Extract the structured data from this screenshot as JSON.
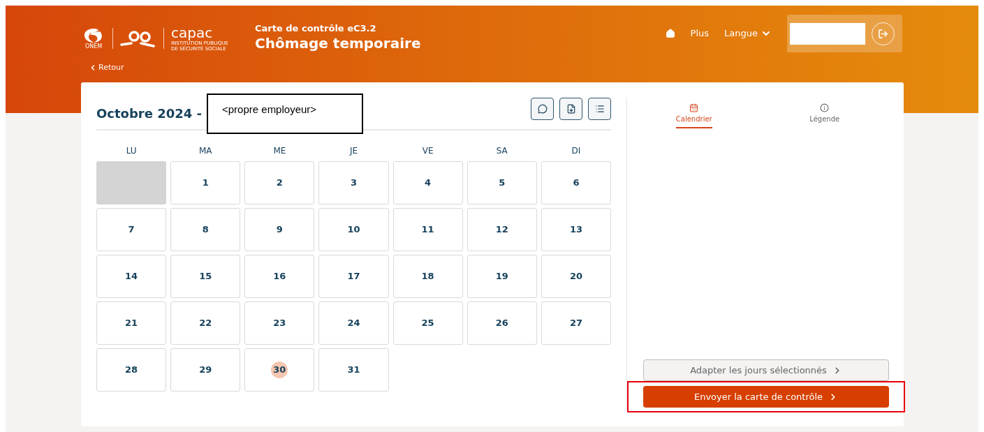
{
  "header": {
    "logo": {
      "onem": "ONEM",
      "capac": "capac",
      "capac_subtitle": "INSTITUTION PUBLIQUE DE SÉCURITÉ SOCIALE"
    },
    "subtitle": "Carte de contrôle eC3.2",
    "title": "Chômage temporaire",
    "nav": [
      {
        "kind": "home"
      },
      {
        "kind": "link",
        "label": "Plus"
      },
      {
        "kind": "dropdown",
        "label": "Langue"
      }
    ],
    "back": "Retour"
  },
  "calendar": {
    "title": "Octobre 2024 -",
    "employer_label": "<propre employeur>",
    "weekdays": [
      "LU",
      "MA",
      "ME",
      "JE",
      "VE",
      "SA",
      "DI"
    ],
    "days": [
      {
        "kind": "outside"
      },
      {
        "kind": "day",
        "label": "1",
        "today": false
      },
      {
        "kind": "day",
        "label": "2",
        "today": false
      },
      {
        "kind": "day",
        "label": "3",
        "today": false
      },
      {
        "kind": "day",
        "label": "4",
        "today": false
      },
      {
        "kind": "day",
        "label": "5",
        "today": false
      },
      {
        "kind": "day",
        "label": "6",
        "today": false
      },
      {
        "kind": "day",
        "label": "7",
        "today": false
      },
      {
        "kind": "day",
        "label": "8",
        "today": false
      },
      {
        "kind": "day",
        "label": "9",
        "today": false
      },
      {
        "kind": "day",
        "label": "10",
        "today": false
      },
      {
        "kind": "day",
        "label": "11",
        "today": false
      },
      {
        "kind": "day",
        "label": "12",
        "today": false
      },
      {
        "kind": "day",
        "label": "13",
        "today": false
      },
      {
        "kind": "day",
        "label": "14",
        "today": false
      },
      {
        "kind": "day",
        "label": "15",
        "today": false
      },
      {
        "kind": "day",
        "label": "16",
        "today": false
      },
      {
        "kind": "day",
        "label": "17",
        "today": false
      },
      {
        "kind": "day",
        "label": "18",
        "today": false
      },
      {
        "kind": "day",
        "label": "19",
        "today": false
      },
      {
        "kind": "day",
        "label": "20",
        "today": false
      },
      {
        "kind": "day",
        "label": "21",
        "today": false
      },
      {
        "kind": "day",
        "label": "22",
        "today": false
      },
      {
        "kind": "day",
        "label": "23",
        "today": false
      },
      {
        "kind": "day",
        "label": "24",
        "today": false
      },
      {
        "kind": "day",
        "label": "25",
        "today": false
      },
      {
        "kind": "day",
        "label": "26",
        "today": false
      },
      {
        "kind": "day",
        "label": "27",
        "today": false
      },
      {
        "kind": "day",
        "label": "28",
        "today": false
      },
      {
        "kind": "day",
        "label": "29",
        "today": false
      },
      {
        "kind": "day",
        "label": "30",
        "today": true
      },
      {
        "kind": "day",
        "label": "31",
        "today": false
      }
    ]
  },
  "side": {
    "tabs": [
      {
        "kind": "calendar",
        "label": "Calendrier",
        "selected": true
      },
      {
        "kind": "info",
        "label": "Légende",
        "selected": false
      }
    ],
    "buttons": [
      {
        "kind": "secondary",
        "label": "Adapter les jours sélectionnés",
        "highlighted": false
      },
      {
        "kind": "primary",
        "label": "Envoyer la carte de contrôle",
        "highlighted": true
      }
    ]
  }
}
